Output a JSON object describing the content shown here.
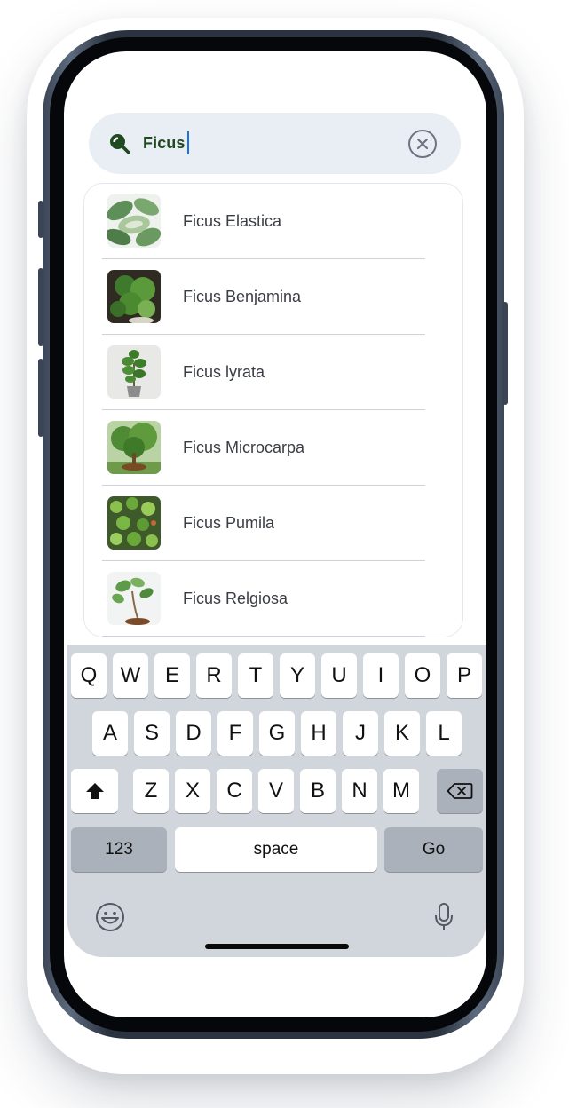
{
  "search": {
    "query": "Ficus",
    "icon": "search-icon",
    "clear_icon": "clear-icon",
    "accent": "#1f4a1f"
  },
  "results": [
    {
      "label": "Ficus Elastica"
    },
    {
      "label": "Ficus Benjamina"
    },
    {
      "label": "Ficus lyrata"
    },
    {
      "label": "Ficus Microcarpa"
    },
    {
      "label": "Ficus Pumila"
    },
    {
      "label": "Ficus Relgiosa"
    }
  ],
  "keyboard": {
    "row1": [
      "Q",
      "W",
      "E",
      "R",
      "T",
      "Y",
      "U",
      "I",
      "O",
      "P"
    ],
    "row2": [
      "A",
      "S",
      "D",
      "F",
      "G",
      "H",
      "J",
      "K",
      "L"
    ],
    "row3": [
      "Z",
      "X",
      "C",
      "V",
      "B",
      "N",
      "M"
    ],
    "numbers_label": "123",
    "space_label": "space",
    "go_label": "Go",
    "shift_icon": "shift-icon",
    "delete_icon": "backspace-icon",
    "emoji_icon": "emoji-icon",
    "mic_icon": "microphone-icon"
  }
}
